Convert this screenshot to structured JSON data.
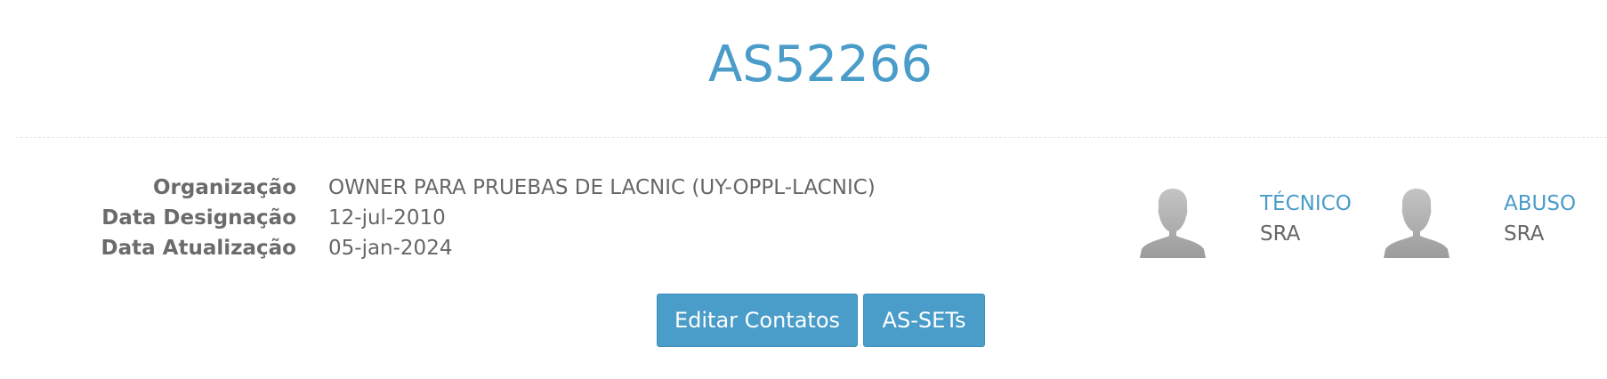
{
  "header": {
    "title": "AS52266"
  },
  "details": [
    {
      "label": "Organização",
      "value": "OWNER PARA PRUEBAS DE LACNIC (UY-OPPL-LACNIC)"
    },
    {
      "label": "Data Designação",
      "value": "12-jul-2010"
    },
    {
      "label": "Data Atualização",
      "value": "05-jan-2024"
    }
  ],
  "contacts": [
    {
      "role": "TÉCNICO",
      "handle": "SRA",
      "icon": "user-avatar-icon"
    },
    {
      "role": "ABUSO",
      "handle": "SRA",
      "icon": "user-avatar-icon"
    }
  ],
  "actions": {
    "edit_contacts_label": "Editar Contatos",
    "as_sets_label": "AS-SETs"
  },
  "colors": {
    "accent": "#4a9cc9",
    "text": "#666666",
    "avatar": "#a9a9a9"
  }
}
